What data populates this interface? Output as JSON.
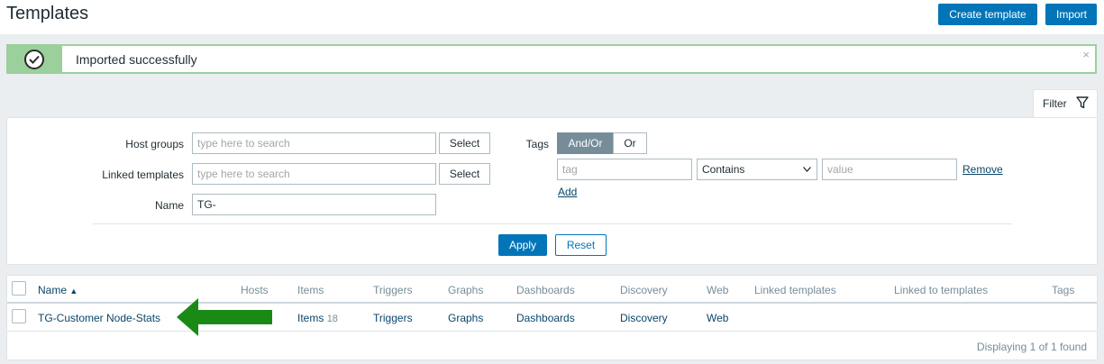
{
  "header": {
    "title": "Templates",
    "create_label": "Create template",
    "import_label": "Import"
  },
  "message": {
    "text": "Imported successfully",
    "close": "×"
  },
  "filter": {
    "tab_label": "Filter",
    "host_groups_label": "Host groups",
    "host_groups_placeholder": "type here to search",
    "linked_templates_label": "Linked templates",
    "linked_templates_placeholder": "type here to search",
    "name_label": "Name",
    "name_value": "TG-",
    "select_label": "Select",
    "tags_label": "Tags",
    "and_or_label": "And/Or",
    "or_label": "Or",
    "tag_placeholder": "tag",
    "operator_value": "Contains",
    "value_placeholder": "value",
    "remove_label": "Remove",
    "add_label": "Add",
    "apply_label": "Apply",
    "reset_label": "Reset"
  },
  "table": {
    "columns": {
      "name": "Name",
      "sort_indicator": "▲",
      "hosts": "Hosts",
      "items": "Items",
      "triggers": "Triggers",
      "graphs": "Graphs",
      "dashboards": "Dashboards",
      "discovery": "Discovery",
      "web": "Web",
      "linked_templates": "Linked templates",
      "linked_to_templates": "Linked to templates",
      "tags": "Tags"
    },
    "rows": [
      {
        "name": "TG-Customer Node-Stats",
        "items": "Items",
        "items_count": "18",
        "triggers": "Triggers",
        "graphs": "Graphs",
        "dashboards": "Dashboards",
        "discovery": "Discovery",
        "web": "Web"
      }
    ],
    "footer": "Displaying 1 of 1 found"
  },
  "annotation": {
    "arrow_icon": "green-left-arrow-icon",
    "arrow_color": "#1a8a17"
  },
  "colors": {
    "primary": "#0275b8",
    "success": "#9bd09c",
    "link": "#0a466a"
  }
}
